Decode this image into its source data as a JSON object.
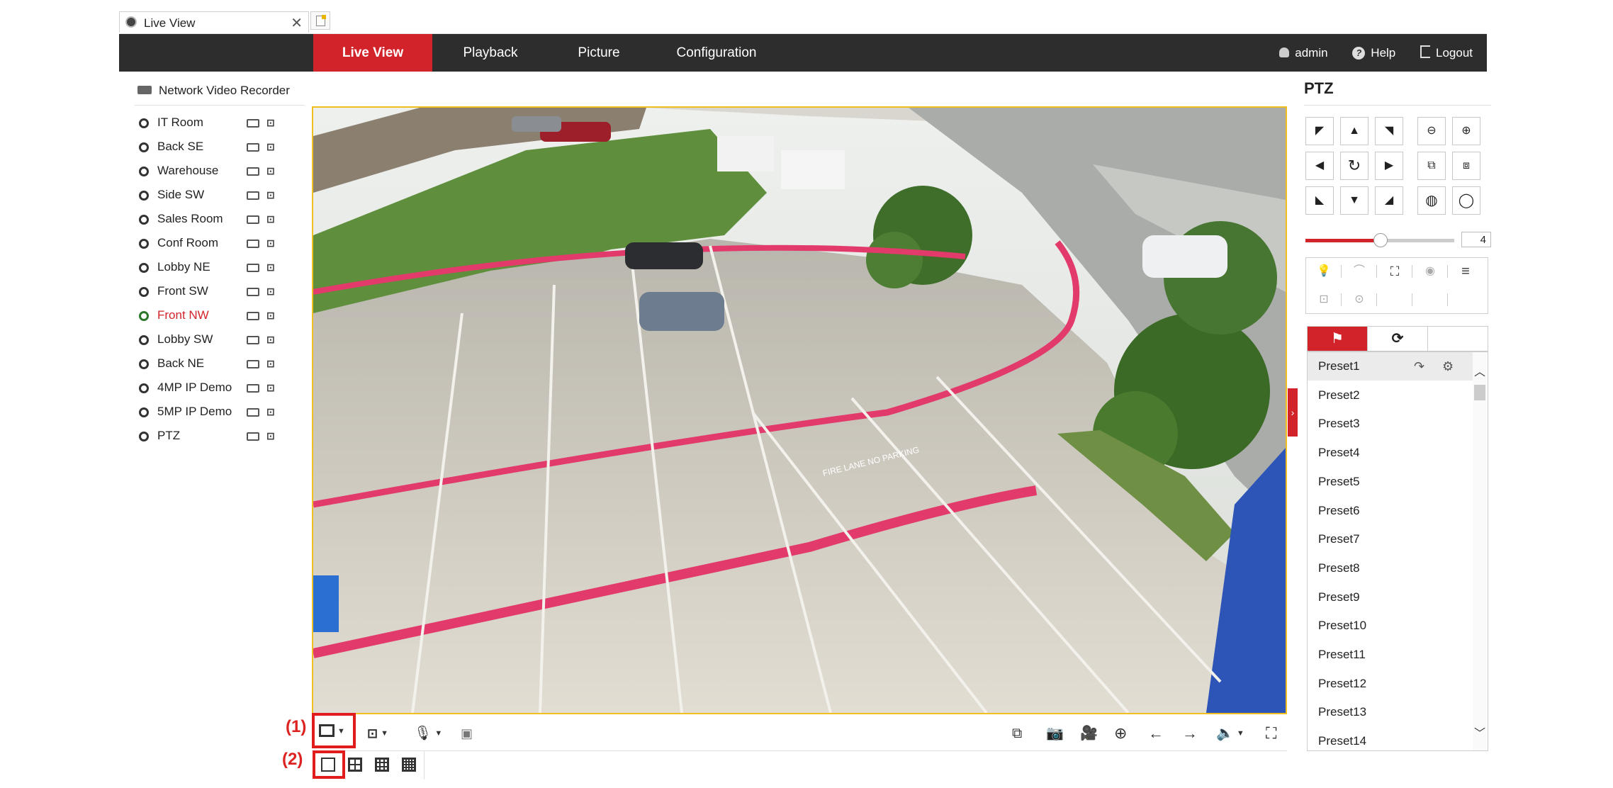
{
  "browser": {
    "tab_title": "Live View",
    "close_glyph": "✕"
  },
  "nav": {
    "items": [
      {
        "label": "Live View",
        "active": true
      },
      {
        "label": "Playback"
      },
      {
        "label": "Picture"
      },
      {
        "label": "Configuration"
      }
    ],
    "user": "admin",
    "help": "Help",
    "logout": "Logout"
  },
  "tree": {
    "root": "Network Video Recorder",
    "cameras": [
      {
        "name": "IT Room"
      },
      {
        "name": "Back SE"
      },
      {
        "name": "Warehouse"
      },
      {
        "name": "Side SW"
      },
      {
        "name": "Sales Room"
      },
      {
        "name": "Conf Room"
      },
      {
        "name": "Lobby NE"
      },
      {
        "name": "Front SW"
      },
      {
        "name": "Front NW",
        "active": true
      },
      {
        "name": "Lobby SW"
      },
      {
        "name": "Back NE"
      },
      {
        "name": "4MP IP Demo"
      },
      {
        "name": "5MP IP Demo"
      },
      {
        "name": "PTZ"
      }
    ]
  },
  "video": {
    "curb_text": "FIRE LANE   NO PARKING"
  },
  "annotations": {
    "first": "(1)",
    "second": "(2)"
  },
  "ptz": {
    "title": "PTZ",
    "speed": "4",
    "tabs": [
      "preset-icon",
      "patrol-icon",
      ""
    ],
    "presets": [
      "Preset1",
      "Preset2",
      "Preset3",
      "Preset4",
      "Preset5",
      "Preset6",
      "Preset7",
      "Preset8",
      "Preset9",
      "Preset10",
      "Preset11",
      "Preset12",
      "Preset13",
      "Preset14"
    ]
  },
  "colors": {
    "accent": "#d2232a",
    "nav_bg": "#2d2d2d",
    "video_border": "#f0c020",
    "annotation": "#e01c1c"
  }
}
